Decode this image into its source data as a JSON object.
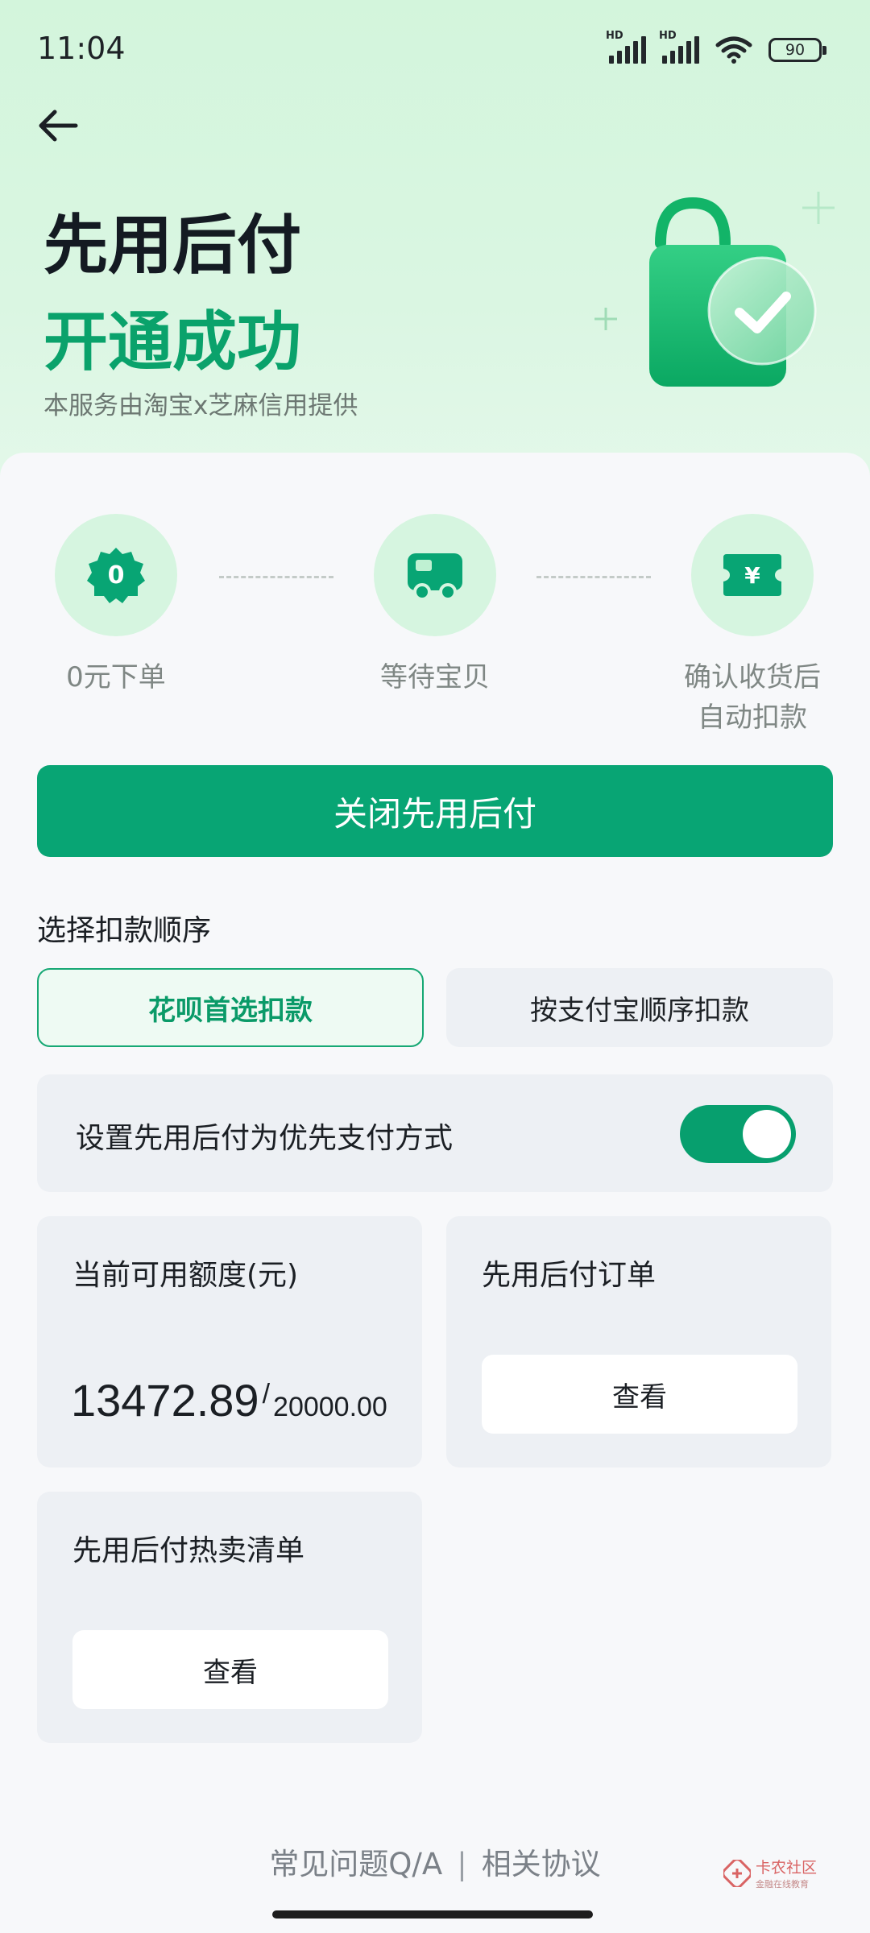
{
  "status_bar": {
    "time": "11:04",
    "battery": "90",
    "signal_badge": "HD"
  },
  "header": {
    "title_line1": "先用后付",
    "title_line2": "开通成功",
    "subtitle": "本服务由淘宝x芝麻信用提供"
  },
  "steps": [
    {
      "icon": "zero-badge-icon",
      "icon_text": "0",
      "label": "0元下单"
    },
    {
      "icon": "delivery-truck-icon",
      "label": "等待宝贝"
    },
    {
      "icon": "yuan-ticket-icon",
      "icon_text": "¥",
      "label_line1": "确认收货后",
      "label_line2": "自动扣款"
    }
  ],
  "close_button": "关闭先用后付",
  "deduction": {
    "title": "选择扣款顺序",
    "options": [
      {
        "label": "花呗首选扣款",
        "selected": true
      },
      {
        "label": "按支付宝顺序扣款",
        "selected": false
      }
    ]
  },
  "preference": {
    "label": "设置先用后付为优先支付方式",
    "enabled": true
  },
  "credit": {
    "title": "当前可用额度(元)",
    "available": "13472.89",
    "separator": "/",
    "total": "20000.00"
  },
  "orders": {
    "title": "先用后付订单",
    "button": "查看"
  },
  "hot_list": {
    "title": "先用后付热卖清单",
    "button": "查看"
  },
  "footer": {
    "faq": "常见问题Q/A",
    "separator": "|",
    "agreement": "相关协议"
  },
  "watermark": {
    "line1": "卡农社区",
    "line2": "金融在线教育"
  },
  "colors": {
    "accent": "#08a574",
    "hero_bg": "#d3f5dc",
    "card_bg": "#edf0f4"
  }
}
